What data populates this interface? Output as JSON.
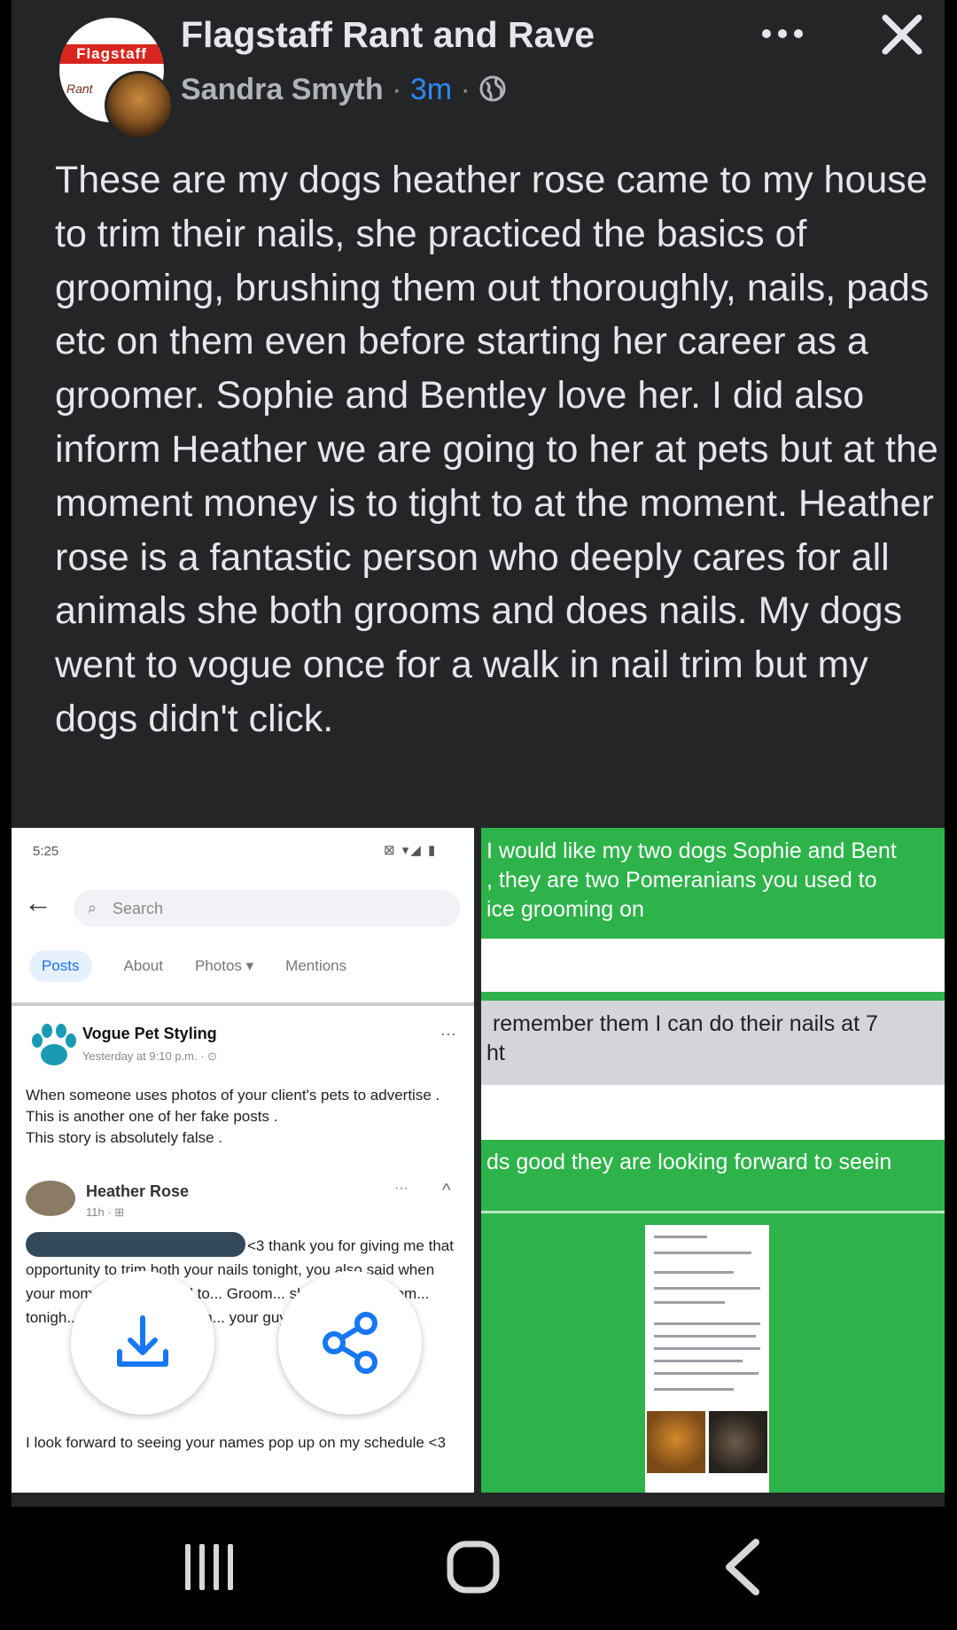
{
  "header": {
    "group_name": "Flagstaff Rant and Rave",
    "author": "Sandra Smyth",
    "time": "3m",
    "separator": "·",
    "group_logo_text": "Flagstaff",
    "group_logo_sub": "Rant"
  },
  "post": {
    "text": "These are my dogs heather rose came to my house to trim their nails, she practiced the basics of grooming, brushing them out thoroughly, nails, pads etc on them even before starting her career as a groomer. Sophie and Bentley love her. I did also inform Heather we are going to her at pets but at the moment money is to tight to at the moment. Heather rose is a fantastic person who deeply cares for all animals she both grooms and does nails. My dogs went to vogue once for a walk in nail trim but my dogs didn't click."
  },
  "left_screenshot": {
    "status_time": "5:25",
    "status_icons": "⊠ ▾◢ ▮",
    "back_arrow": "←",
    "search_placeholder": "Search",
    "tabs": [
      "Posts",
      "About",
      "Photos ▾",
      "Mentions"
    ],
    "page_name": "Vogue Pet Styling",
    "page_time": "Yesterday at 9:10 p.m. · ⊙",
    "menu_dots": "···",
    "body": "When someone uses photos of your client's pets to advertise .\nThis is another one of her fake posts .\nThis story is absolutely false .",
    "commenter": "Heather Rose",
    "comment_meta": "11h · ⊞",
    "caret": "^",
    "comment_text": "<3 thank you for giving me that opportunity to trim both your nails tonight, you also said when your mom... she was sad to... Groom... she was p... groom... tonigh... e is follo... and wan... your guys g... n <3",
    "footer": "I look forward to seeing your names pop up on my schedule <3"
  },
  "right_screenshot": {
    "text1": "I would like my two dogs Sophie and Bent\n, they are two Pomeranians you used to\nice grooming on",
    "text_gray": " remember them I can do their nails at 7\nht",
    "text2": "ds good they are looking forward to seein"
  },
  "actions": {
    "download_icon": "download-icon",
    "share_icon": "share-icon"
  },
  "colors": {
    "background": "#242526",
    "text": "#e4e6eb",
    "secondary": "#b0b3b8",
    "link_blue": "#2d88ff",
    "green": "#2db34a",
    "fab_icon": "#1877f2"
  }
}
